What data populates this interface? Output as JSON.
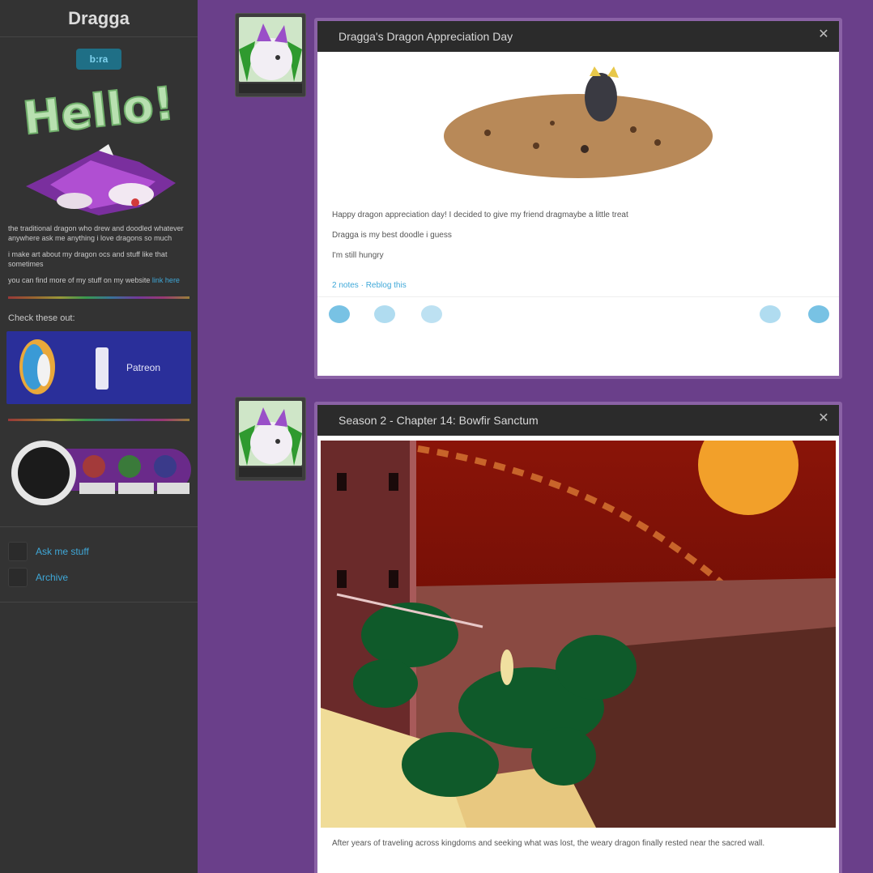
{
  "sidebar": {
    "title": "Dragga",
    "badge": "b:ra",
    "hello": "Hello!",
    "about_1": "the traditional dragon who drew and doodled whatever anywhere ask me anything i love dragons so much",
    "about_2": "i make art about my dragon ocs and stuff like that sometimes",
    "about_3": "you can find more of my stuff on my website ",
    "about_3_link": "link here",
    "subhead": "Check these out:",
    "banner_text": "Patreon",
    "links": [
      {
        "label": "Ask me stuff",
        "icon": "mail-icon"
      },
      {
        "label": "Archive",
        "icon": "archive-icon"
      }
    ]
  },
  "posts": [
    {
      "title": "Dragga's Dragon Appreciation Day",
      "lines": [
        "Happy dragon appreciation day! I decided to give my friend dragmaybe a little treat",
        "Dragga is my best doodle i guess",
        "I'm still hungry"
      ],
      "link": "2 notes · Reblog this"
    },
    {
      "title": "Season 2 - Chapter 14: Bowfir Sanctum",
      "caption": "After years of traveling across kingdoms and seeking what was lost, the weary dragon finally rested near the sacred wall."
    }
  ],
  "colors": {
    "page_bg": "#6a3f8a",
    "sidebar_bg": "#333333",
    "link": "#3fa8d8"
  }
}
